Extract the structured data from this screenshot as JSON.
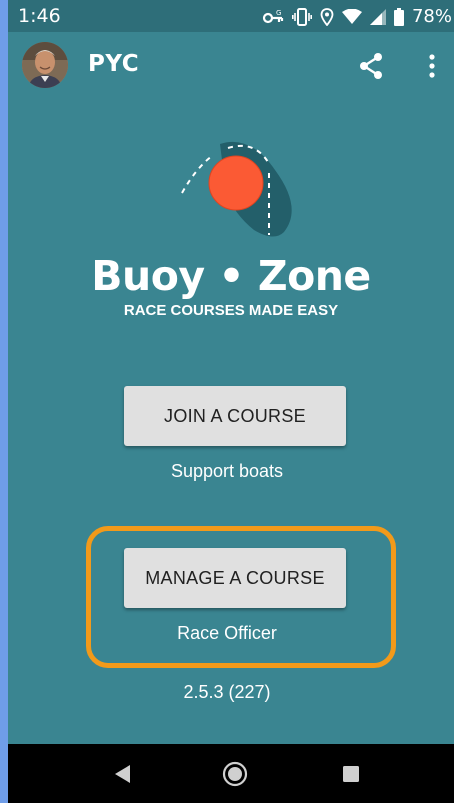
{
  "status_bar": {
    "time": "1:46",
    "battery": "78%",
    "icons": [
      "vpn-key-icon",
      "vibrate-icon",
      "location-icon",
      "wifi-icon",
      "signal-icon",
      "battery-icon"
    ]
  },
  "app_bar": {
    "title": "PYC",
    "actions": [
      "share-icon",
      "more-vert-icon"
    ]
  },
  "brand": {
    "name": "Buoy • Zone",
    "tagline": "RACE COURSES MADE EASY"
  },
  "join": {
    "button_label": "JOIN A COURSE",
    "subtitle": "Support boats"
  },
  "manage": {
    "button_label": "MANAGE A COURSE",
    "subtitle": "Race Officer"
  },
  "version": "2.5.3 (227)",
  "colors": {
    "background": "#3a8591",
    "status_bar": "#2e6e79",
    "highlight": "#f29a1a",
    "buoy": "#fb5a34",
    "button": "#e0e0e0"
  }
}
